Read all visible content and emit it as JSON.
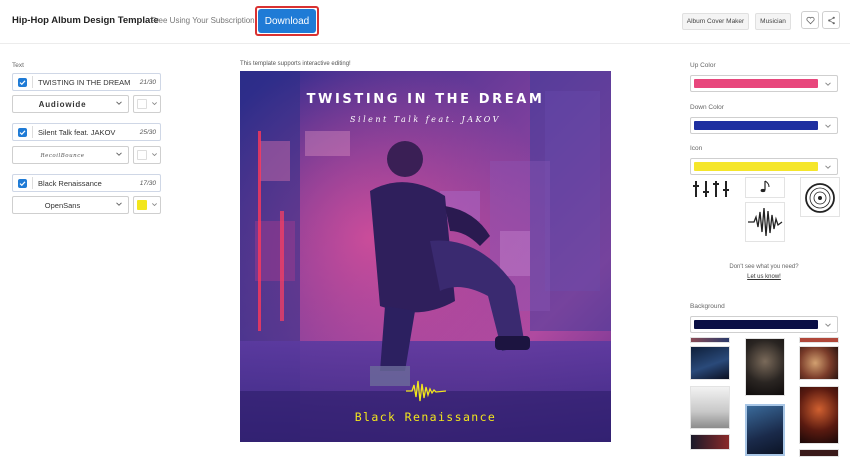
{
  "header": {
    "title": "Hip-Hop Album Design Template",
    "subtitle": "Free Using Your Subscription!",
    "download_label": "Download",
    "tags": [
      "Album Cover Maker",
      "Musician"
    ]
  },
  "left_panel": {
    "section_label": "Text",
    "text_fields": [
      {
        "value": "TWISTING IN THE DREAM",
        "count": "21/30",
        "checked": true,
        "font": "Audiowide",
        "color": "#ffffff"
      },
      {
        "value": "Silent Talk feat. JAKOV",
        "count": "25/30",
        "checked": true,
        "font": "RecoilBounce",
        "color": "#ffffff"
      },
      {
        "value": "Black Renaissance",
        "count": "17/30",
        "checked": true,
        "font": "OpenSans",
        "color": "#f2e61c"
      }
    ]
  },
  "center": {
    "notice": "This template supports interactive editing!",
    "cover": {
      "title": "TWISTING IN THE DREAM",
      "subtitle": "Silent Talk feat. JAKOV",
      "album": "Black Renaissance"
    }
  },
  "right_panel": {
    "up_color_label": "Up Color",
    "up_color": "#e8467c",
    "down_color_label": "Down Color",
    "down_color": "#1e2fa0",
    "icon_label": "Icon",
    "icon_color": "#f5e62a",
    "icons": [
      "equalizer-icon",
      "music-note-icon",
      "vinyl-record-icon",
      "waveform-icon"
    ],
    "help_text": "Don't see what you need?",
    "help_link": "Let us know!",
    "background_label": "Background",
    "background_color": "#0a0f45"
  }
}
